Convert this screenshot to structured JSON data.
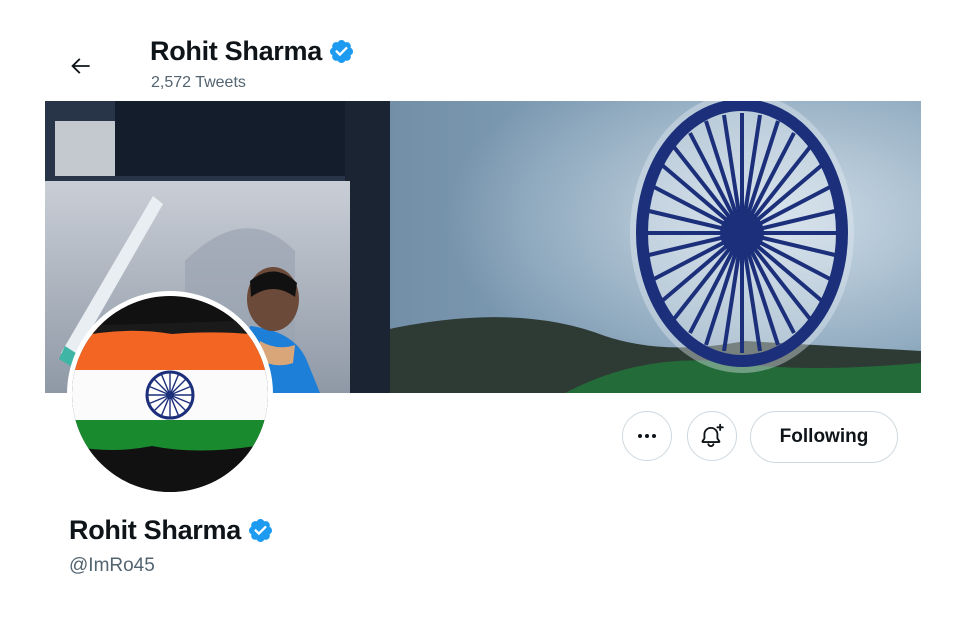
{
  "header": {
    "name": "Rohit Sharma",
    "tweet_count": "2,572 Tweets"
  },
  "icons": {
    "back": "arrow-left-icon",
    "verified": "verified-badge-icon",
    "more": "more-options-icon",
    "notify": "bell-plus-icon"
  },
  "profile": {
    "display_name": "Rohit Sharma",
    "handle": "@ImRo45"
  },
  "actions": {
    "following_label": "Following"
  },
  "colors": {
    "verified_blue": "#1d9bf0",
    "text_primary": "#0f1419",
    "text_secondary": "#536471",
    "border": "#cfd9de",
    "saffron": "#f26522",
    "green": "#1a8a2e",
    "chakra_navy": "#1c2f7a"
  }
}
